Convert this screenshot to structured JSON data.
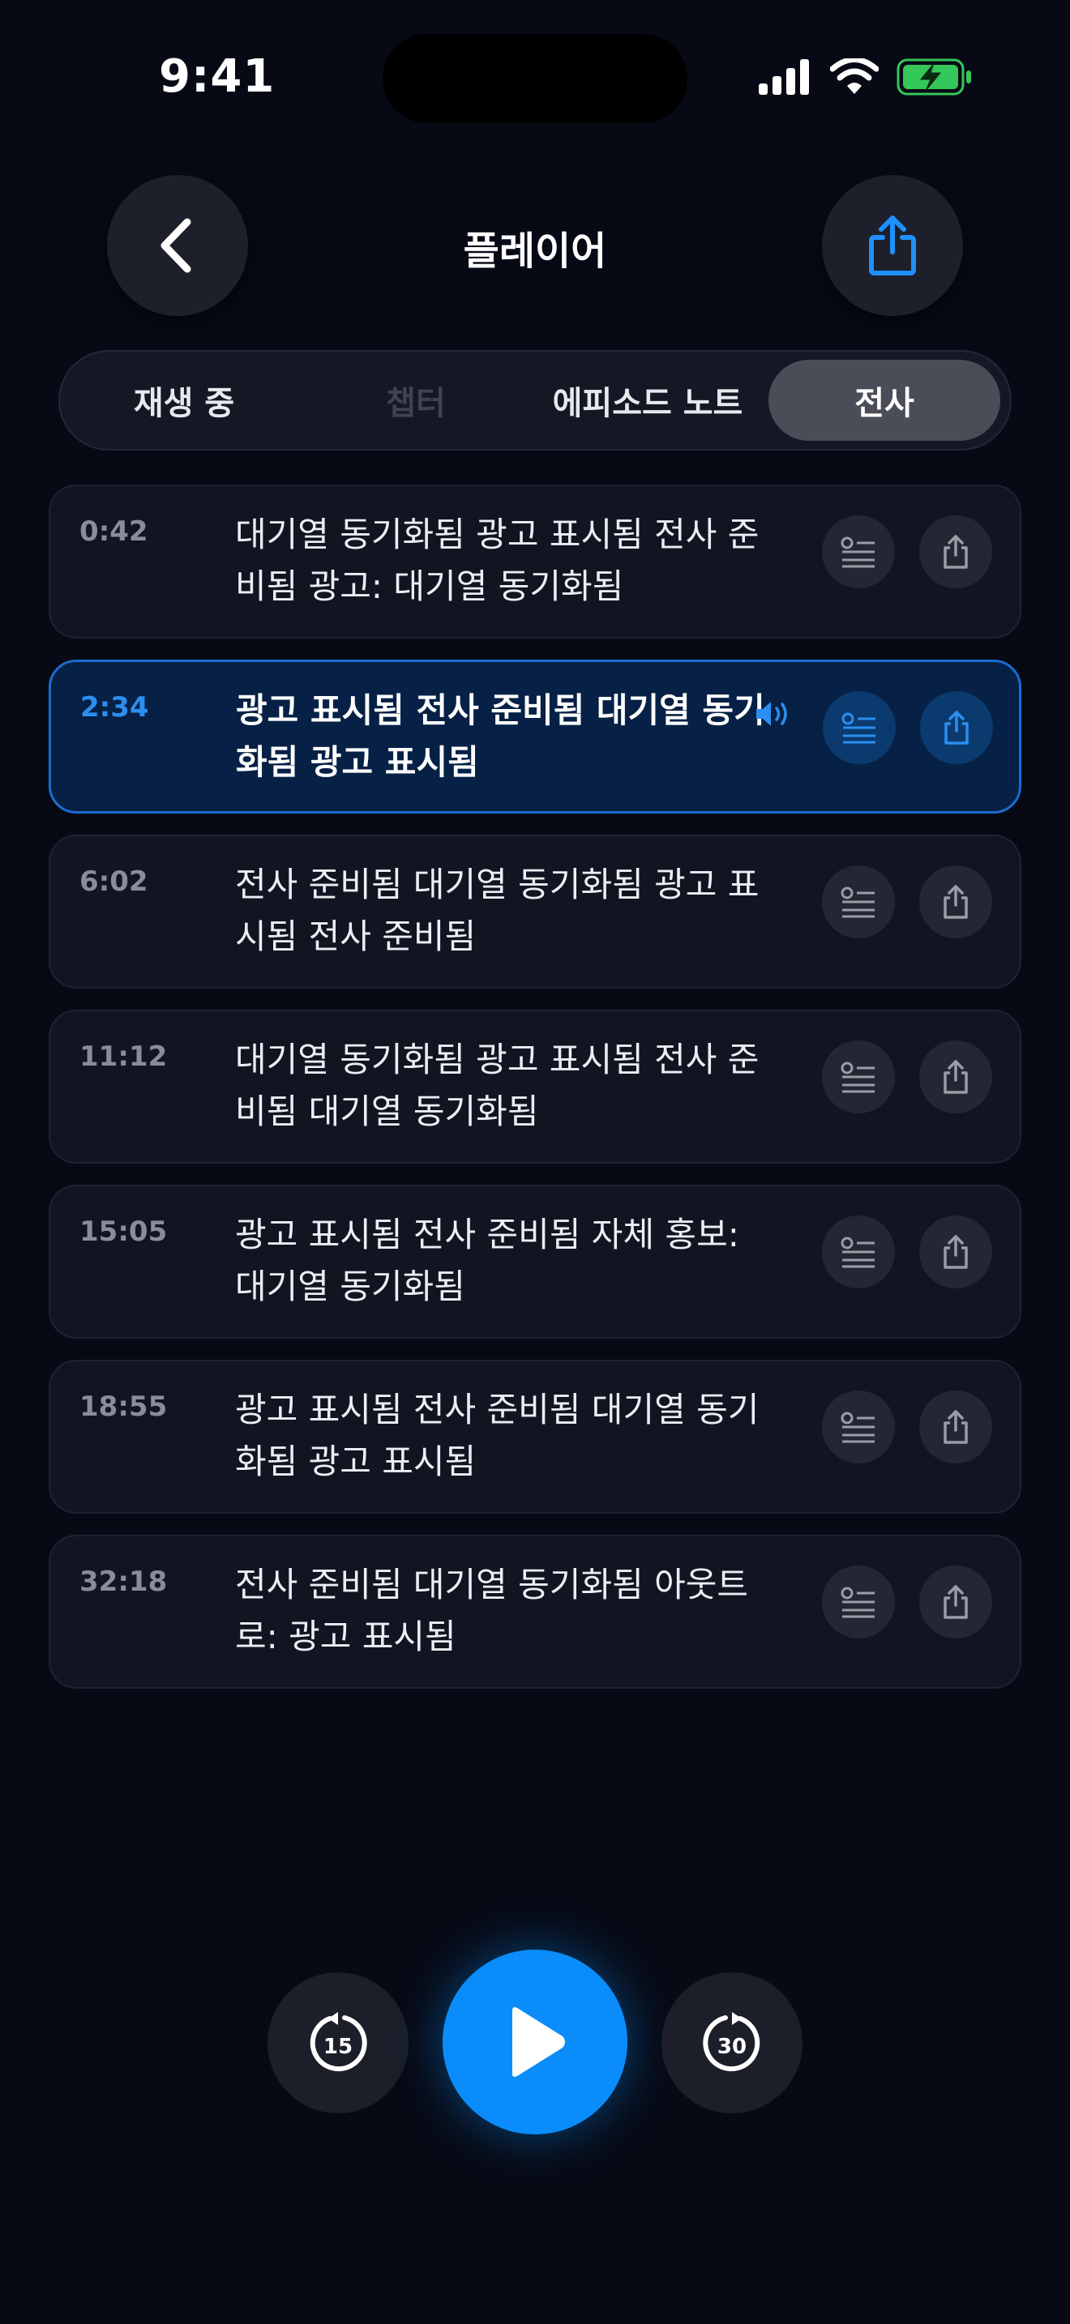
{
  "status": {
    "time": "9:41"
  },
  "header": {
    "title": "플레이어"
  },
  "tabs": [
    {
      "label": "재생 중",
      "state": "normal"
    },
    {
      "label": "챕터",
      "state": "disabled"
    },
    {
      "label": "에피소드 노트",
      "state": "normal"
    },
    {
      "label": "전사",
      "state": "active"
    }
  ],
  "transcript": [
    {
      "time": "0:42",
      "text": "대기열 동기화됨 광고 표시됨 전사 준비됨 광고: 대기열 동기화됨",
      "active": false
    },
    {
      "time": "2:34",
      "text": "광고 표시됨 전사 준비됨 대기열 동기화됨 광고 표시됨",
      "active": true
    },
    {
      "time": "6:02",
      "text": "전사 준비됨 대기열 동기화됨 광고 표시됨 전사 준비됨",
      "active": false
    },
    {
      "time": "11:12",
      "text": "대기열 동기화됨 광고 표시됨 전사 준비됨 대기열 동기화됨",
      "active": false
    },
    {
      "time": "15:05",
      "text": "광고 표시됨 전사 준비됨 자체 홍보: 대기열 동기화됨",
      "active": false
    },
    {
      "time": "18:55",
      "text": "광고 표시됨 전사 준비됨 대기열 동기화됨 광고 표시됨",
      "active": false
    },
    {
      "time": "32:18",
      "text": "전사 준비됨 대기열 동기화됨 아웃트로: 광고 표시됨",
      "active": false
    }
  ],
  "player": {
    "skip_back": "15",
    "skip_forward": "30"
  },
  "colors": {
    "accent": "#0a8dfb",
    "background": "#070a15",
    "battery": "#34c759"
  }
}
